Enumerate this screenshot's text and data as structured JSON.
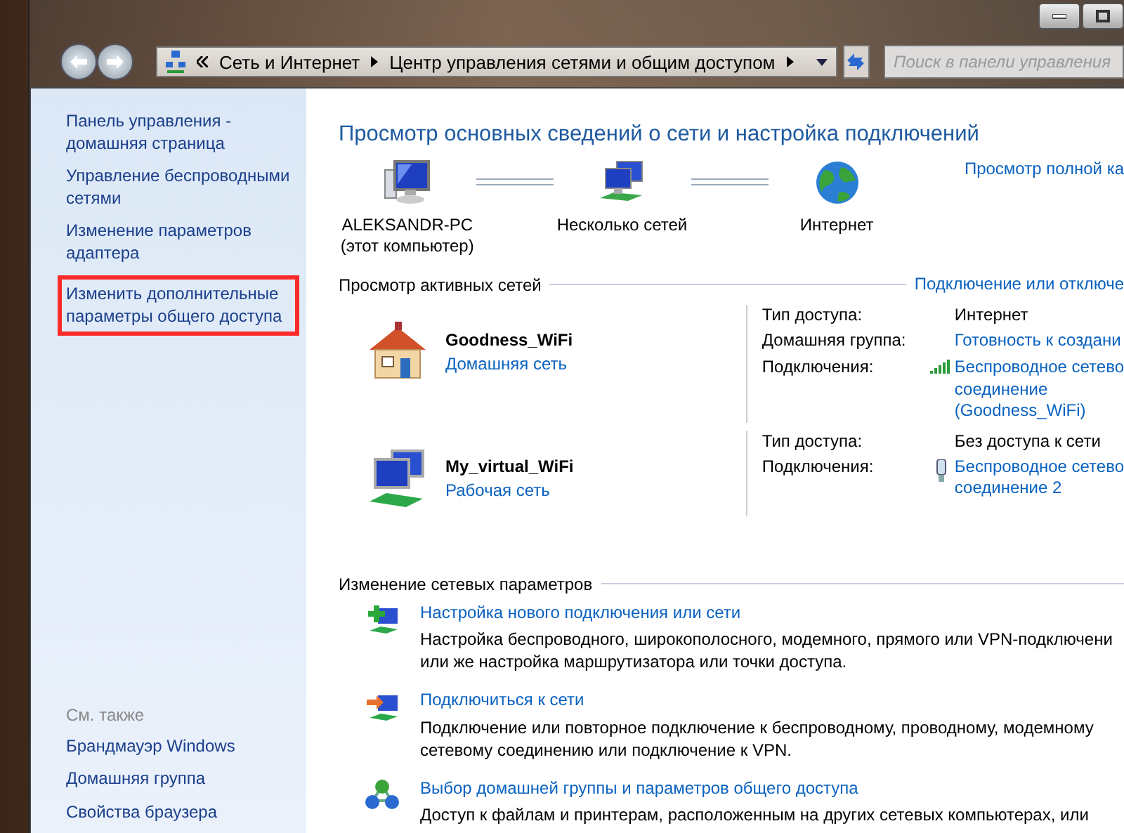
{
  "toolbar": {
    "breadcrumb": [
      "Сеть и Интернет",
      "Центр управления сетями и общим доступом"
    ],
    "search": {
      "placeholder": "Поиск в панели управления"
    }
  },
  "sidebar": {
    "items": [
      {
        "label": "Панель управления -\nдомашняя страница",
        "highlighted": false
      },
      {
        "label": "Управление беспроводными\nсетями",
        "highlighted": false
      },
      {
        "label": "Изменение параметров\nадаптера",
        "highlighted": false
      },
      {
        "label": "Изменить дополнительные\nпараметры общего доступа",
        "highlighted": true
      }
    ],
    "see_also": {
      "title": "См. также",
      "items": [
        "Брандмауэр Windows",
        "Домашняя группа",
        "Свойства браузера"
      ]
    }
  },
  "content": {
    "title": "Просмотр основных сведений о сети и настройка подключений",
    "map": {
      "link": "Просмотр полной ка",
      "nodes": [
        {
          "kind": "computer",
          "label": "ALEKSANDR-PC\n(этот компьютер)"
        },
        {
          "kind": "networks",
          "label": "Несколько сетей"
        },
        {
          "kind": "internet",
          "label": "Интернет"
        }
      ]
    },
    "active_networks": {
      "title": "Просмотр активных сетей",
      "link": "Подключение или отключе",
      "networks": [
        {
          "kind": "home",
          "name": "Goodness_WiFi",
          "type": "Домашняя сеть",
          "properties": [
            {
              "label": "Тип доступа:",
              "value": "Интернет",
              "kind": "text"
            },
            {
              "label": "Домашняя группа:",
              "value": "Готовность к создани",
              "kind": "link"
            },
            {
              "label": "Подключения:",
              "value": "Беспроводное сетево\nсоединение\n(Goodness_WiFi)",
              "kind": "connection"
            }
          ]
        },
        {
          "kind": "work",
          "name": "My_virtual_WiFi",
          "type": "Рабочая сеть",
          "properties": [
            {
              "label": "Тип доступа:",
              "value": "Без доступа к сети",
              "kind": "text"
            },
            {
              "label": "Подключения:",
              "value": "Беспроводное сетево\nсоединение 2",
              "kind": "connection"
            }
          ]
        }
      ]
    },
    "tasks": {
      "title": "Изменение сетевых параметров",
      "items": [
        {
          "kind": "new",
          "title": "Настройка нового подключения или сети",
          "description": "Настройка беспроводного, широкополосного, модемного, прямого или VPN-подключени\nили же настройка маршрутизатора или точки доступа."
        },
        {
          "kind": "connect",
          "title": "Подключиться к сети",
          "description": "Подключение или повторное подключение к беспроводному, проводному, модемному\nсетевому соединению или подключение к VPN."
        },
        {
          "kind": "homegroup",
          "title": "Выбор домашней группы и параметров общего доступа",
          "description": "Доступ к файлам и принтерам, расположенным на других сетевых компьютерах, или"
        }
      ]
    }
  }
}
